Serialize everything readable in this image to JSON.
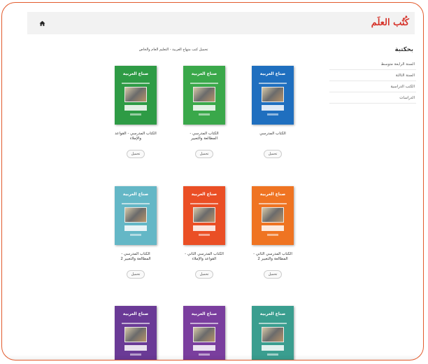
{
  "header": {
    "logo": "كُتُب العلَم",
    "home_icon": "home-icon"
  },
  "sidebar": {
    "title": "بحكتبة",
    "items": [
      {
        "label": "السنة الرابعة متوسط"
      },
      {
        "label": "السنة الثالثة"
      },
      {
        "label": "الكتب الدراسية"
      },
      {
        "label": "الدراسات"
      }
    ]
  },
  "main": {
    "intro": "تحميل كتب منهاج العربية - التعليم العام والخاص",
    "books": [
      {
        "cover_title": "صناع العربية",
        "color": "#1f6fbf",
        "caption": "الكتاب المدرسي",
        "button": "تحميل"
      },
      {
        "cover_title": "صناع العربية",
        "color": "#3aa84a",
        "caption": "الكتاب المدرسي - المطالعة والتعبير",
        "button": "تحميل"
      },
      {
        "cover_title": "صناع العربية",
        "color": "#2e9b45",
        "caption": "الكتاب المدرسي - القواعد والإملاء",
        "button": "تحميل"
      },
      {
        "cover_title": "صناع العربية",
        "color": "#ef7422",
        "caption": "الكتاب المدرسي الثاني - المطالعة والتعبير 2",
        "button": "تحميل"
      },
      {
        "cover_title": "صناع العربية",
        "color": "#ea4f25",
        "caption": "الكتاب المدرسي الثاني - القواعد والإملاء",
        "button": "تحميل"
      },
      {
        "cover_title": "صناع العربية",
        "color": "#64b7c6",
        "caption": "الكتاب المدرسي - المطالعة والتعبير 2",
        "button": "تحميل"
      },
      {
        "cover_title": "صناع العربية",
        "color": "#3a9e8f",
        "caption": "",
        "button": ""
      },
      {
        "cover_title": "صناع العربية",
        "color": "#7a3e9e",
        "caption": "",
        "button": ""
      },
      {
        "cover_title": "صناع العربية",
        "color": "#6a3a96",
        "caption": "",
        "button": ""
      }
    ]
  }
}
